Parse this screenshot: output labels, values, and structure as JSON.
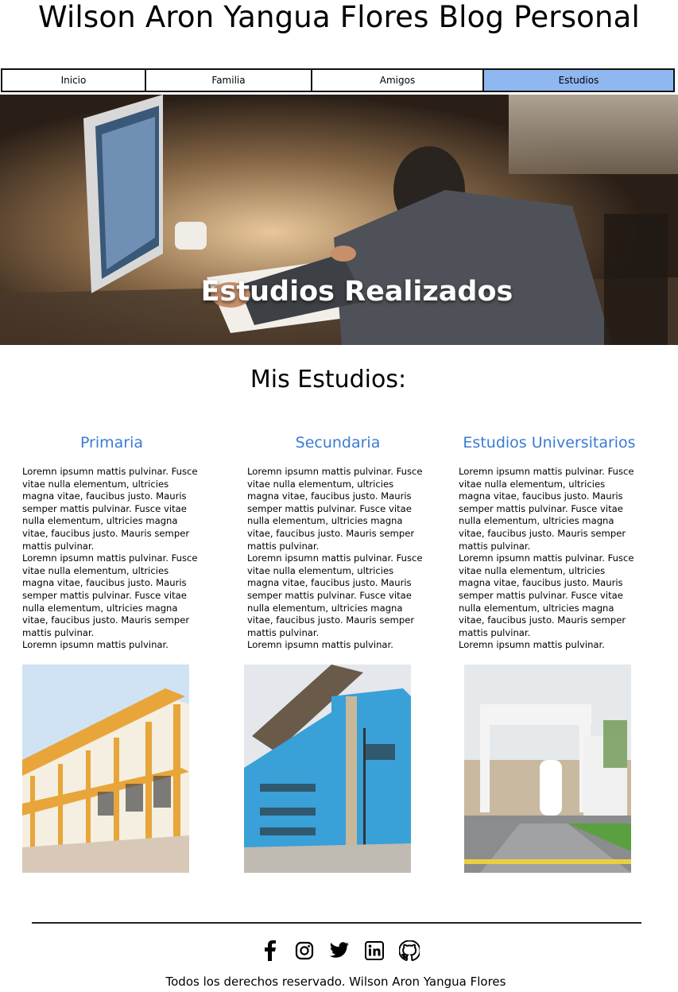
{
  "site": {
    "title": "Wilson Aron Yangua Flores Blog Personal"
  },
  "nav": {
    "items": [
      {
        "label": "Inicio"
      },
      {
        "label": "Familia"
      },
      {
        "label": "Amigos"
      },
      {
        "label": "Estudios"
      }
    ],
    "active": "Estudios",
    "active_color": "#8fb7f0"
  },
  "hero": {
    "title": "Estudios Realizados"
  },
  "main": {
    "title": "Mis Estudios:",
    "accent": "#3a7bd5",
    "columns": [
      {
        "heading": "Primaria",
        "text": "Loremn ipsumn mattis pulvinar. Fusce vitae nulla elementum, ultricies magna vitae, faucibus justo. Mauris semper mattis pulvinar. Fusce vitae nulla elementum, ultricies magna vitae, faucibus justo. Mauris semper mattis pulvinar.\nLoremn ipsumn mattis pulvinar. Fusce vitae nulla elementum, ultricies magna vitae, faucibus justo. Mauris semper mattis pulvinar. Fusce vitae nulla elementum, ultricies magna vitae, faucibus justo. Mauris semper mattis pulvinar.\nLoremn ipsumn mattis pulvinar."
      },
      {
        "heading": "Secundaria",
        "text": "Loremn ipsumn mattis pulvinar. Fusce vitae nulla elementum, ultricies magna vitae, faucibus justo. Mauris semper mattis pulvinar. Fusce vitae nulla elementum, ultricies magna vitae, faucibus justo. Mauris semper mattis pulvinar.\nLoremn ipsumn mattis pulvinar. Fusce vitae nulla elementum, ultricies magna vitae, faucibus justo. Mauris semper mattis pulvinar. Fusce vitae nulla elementum, ultricies magna vitae, faucibus justo. Mauris semper mattis pulvinar.\nLoremn ipsumn mattis pulvinar."
      },
      {
        "heading": "Estudios Universitarios",
        "text": "Loremn ipsumn mattis pulvinar. Fusce vitae nulla elementum, ultricies magna vitae, faucibus justo. Mauris semper mattis pulvinar. Fusce vitae nulla elementum, ultricies magna vitae, faucibus justo. Mauris semper mattis pulvinar.\nLoremn ipsumn mattis pulvinar. Fusce vitae nulla elementum, ultricies magna vitae, faucibus justo. Mauris semper mattis pulvinar. Fusce vitae nulla elementum, ultricies magna vitae, faucibus justo. Mauris semper mattis pulvinar.\nLoremn ipsumn mattis pulvinar."
      }
    ]
  },
  "footer": {
    "social_icons": [
      "facebook-icon",
      "instagram-icon",
      "twitter-icon",
      "linkedin-icon",
      "github-icon"
    ],
    "copyright": "Todos los derechos reservado. Wilson Aron Yangua Flores"
  }
}
